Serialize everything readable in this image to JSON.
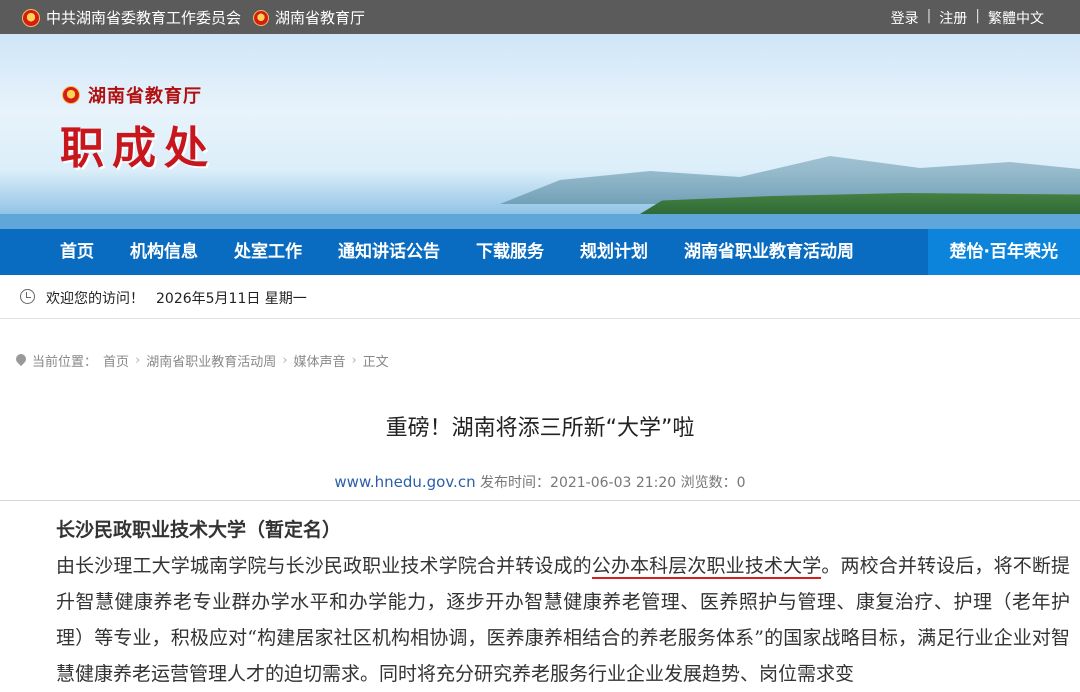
{
  "topbar": {
    "org1": "中共湖南省委教育工作委员会",
    "org2": "湖南省教育厅",
    "links": [
      "登录",
      "注册",
      "繁體中文"
    ]
  },
  "banner": {
    "dept": "湖南省教育厅",
    "office": "职成处"
  },
  "nav": {
    "items": [
      "首页",
      "机构信息",
      "处室工作",
      "通知讲话公告",
      "下载服务",
      "规划计划",
      "湖南省职业教育活动周",
      "楚怡·百年荣光"
    ]
  },
  "welcome": {
    "greeting": "欢迎您的访问！",
    "date": "2026年5月11日 星期一"
  },
  "breadcrumb": {
    "label": "当前位置：",
    "items": [
      "首页",
      "湖南省职业教育活动周",
      "媒体声音",
      "正文"
    ]
  },
  "article": {
    "title": "重磅！湖南将添三所新“大学”啦",
    "site": "www.hnedu.gov.cn",
    "publish": "发布时间：2021-06-03 21:20",
    "views": "浏览数：0",
    "subtitle": "长沙民政职业技术大学（暂定名）",
    "para_pre": "由长沙理工大学城南学院与长沙民政职业技术学院合并转设成的",
    "para_hl": "公办本科层次职业技术大学",
    "para_post": "。两校合并转设后，将不断提升智慧健康养老专业群办学水平和办学能力，逐步开办智慧健康养老管理、医养照护与管理、康复治疗、护理（老年护理）等专业，积极应对“构建居家社区机构相协调，医养康养相结合的养老服务体系”的国家战略目标，满足行业企业对智慧健康养老运营管理人才的迫切需求。同时将充分研究养老服务行业企业发展趋势、岗位需求变"
  }
}
